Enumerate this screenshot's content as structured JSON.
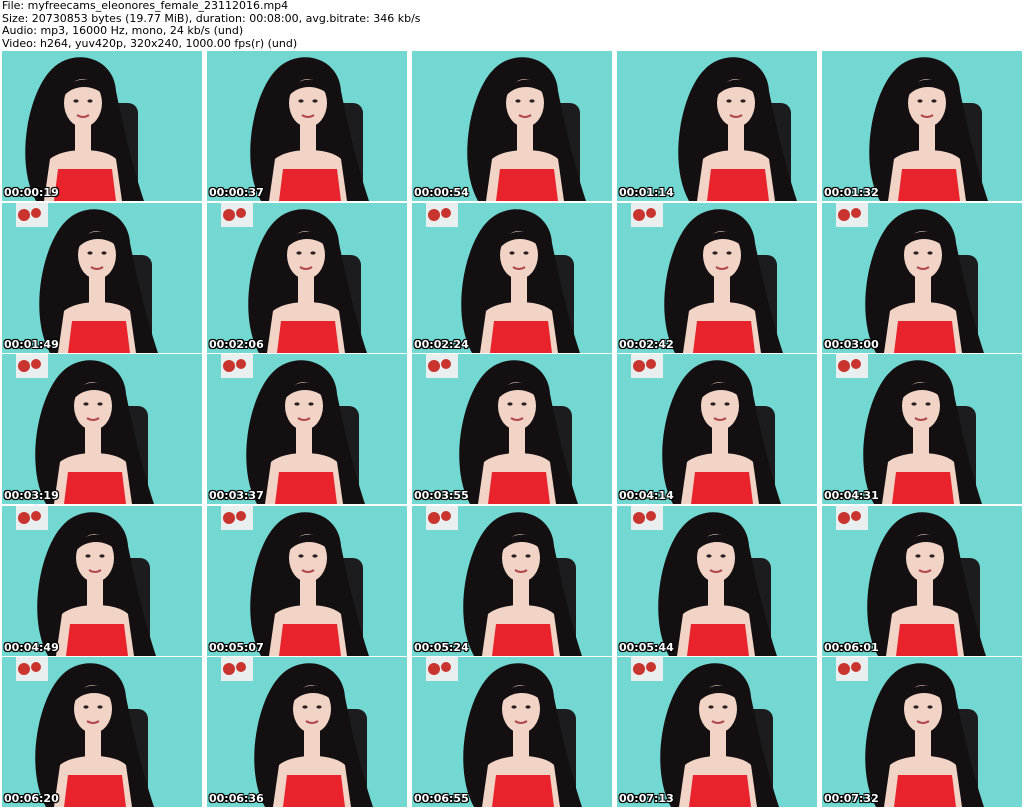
{
  "header": {
    "file_line": "File: myfreecams_eleonores_female_23112016.mp4",
    "size_line": "Size: 20730853 bytes (19.77 MiB), duration: 00:08:00, avg.bitrate: 346 kb/s",
    "audio_line": "Audio: mp3, 16000 Hz, mono, 24 kb/s (und)",
    "video_line": "Video: h264, yuv420p, 320x240, 1000.00 fps(r) (und)"
  },
  "colors": {
    "background_wall": "#5fd3cb",
    "hair": "#141012",
    "skin": "#f1d4c6",
    "top": "#e8232c",
    "chair": "#1c1c1e",
    "poster": "#c9342f"
  },
  "thumbnails": [
    {
      "timestamp": "00:00:19"
    },
    {
      "timestamp": "00:00:37"
    },
    {
      "timestamp": "00:00:54"
    },
    {
      "timestamp": "00:01:14"
    },
    {
      "timestamp": "00:01:32"
    },
    {
      "timestamp": "00:01:49"
    },
    {
      "timestamp": "00:02:06"
    },
    {
      "timestamp": "00:02:24"
    },
    {
      "timestamp": "00:02:42"
    },
    {
      "timestamp": "00:03:00"
    },
    {
      "timestamp": "00:03:19"
    },
    {
      "timestamp": "00:03:37"
    },
    {
      "timestamp": "00:03:55"
    },
    {
      "timestamp": "00:04:14"
    },
    {
      "timestamp": "00:04:31"
    },
    {
      "timestamp": "00:04:49"
    },
    {
      "timestamp": "00:05:07"
    },
    {
      "timestamp": "00:05:24"
    },
    {
      "timestamp": "00:05:44"
    },
    {
      "timestamp": "00:06:01"
    },
    {
      "timestamp": "00:06:20"
    },
    {
      "timestamp": "00:06:36"
    },
    {
      "timestamp": "00:06:55"
    },
    {
      "timestamp": "00:07:13"
    },
    {
      "timestamp": "00:07:32"
    }
  ]
}
